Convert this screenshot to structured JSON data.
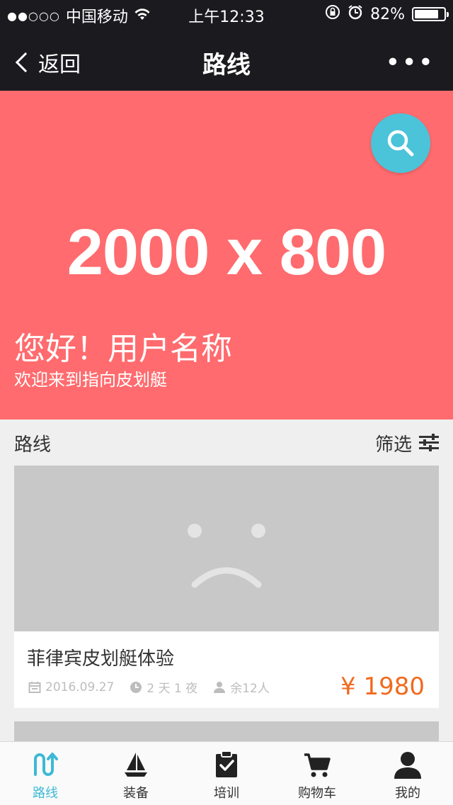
{
  "status_bar": {
    "signal": "●●○○○",
    "carrier": "中国移动",
    "time": "上午12:33",
    "battery": "82%",
    "battery_level": 0.82
  },
  "nav": {
    "back_label": "返回",
    "title": "路线",
    "more_label": "•••"
  },
  "banner": {
    "size_text": "2000 x 800",
    "greeting": "您好！用户名称",
    "welcome": "欢迎来到指向皮划艇",
    "bg_color": "#ff6b6e",
    "search_color": "#4bc3d9"
  },
  "section": {
    "title": "路线",
    "filter_label": "筛选"
  },
  "routes": [
    {
      "title": "菲律宾皮划艇体验",
      "date": "2016.09.27",
      "duration": "2 天 1 夜",
      "remaining": "余12人",
      "price": "¥ 1980"
    }
  ],
  "tabs": [
    {
      "label": "路线",
      "icon": "route-icon",
      "active": true
    },
    {
      "label": "装备",
      "icon": "sailboat-icon",
      "active": false
    },
    {
      "label": "培训",
      "icon": "clipboard-check-icon",
      "active": false
    },
    {
      "label": "购物车",
      "icon": "cart-icon",
      "active": false
    },
    {
      "label": "我的",
      "icon": "user-icon",
      "active": false
    }
  ],
  "colors": {
    "accent": "#3cb9d6",
    "price": "#f26a1f",
    "dark_bar": "#1b1b1f"
  }
}
